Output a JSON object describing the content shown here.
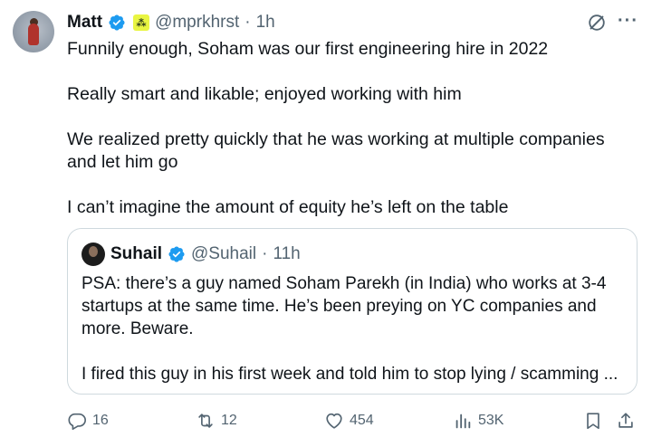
{
  "tweet": {
    "author": {
      "name": "Matt",
      "handle": "@mprkhrst",
      "separator": "·",
      "time": "1h",
      "verified_color": "#1d9bf0"
    },
    "paragraphs": [
      "Funnily enough, Soham was our first engineering hire in 2022",
      "Really smart and likable; enjoyed working with him",
      "We realized pretty quickly that he was working at multiple companies and let him go",
      "I can’t imagine the amount of equity he’s left on the table"
    ],
    "quote": {
      "author": {
        "name": "Suhail",
        "handle": "@Suhail",
        "separator": "·",
        "time": "11h"
      },
      "paragraphs": [
        "PSA: there’s a guy named Soham Parekh (in India) who works at 3-4 startups at the same time. He’s been preying on YC companies and more. Beware.",
        "I fired this guy in his first week and told him to stop lying / scamming ..."
      ]
    },
    "metrics": {
      "replies": "16",
      "reposts": "12",
      "likes": "454",
      "views": "53K"
    },
    "icons": {
      "grok": "grok-icon",
      "more": "more-icon",
      "reply": "reply-icon",
      "repost": "repost-icon",
      "like": "heart-icon",
      "views": "views-icon",
      "bookmark": "bookmark-icon",
      "share": "share-icon"
    },
    "colors": {
      "text": "#0f1419",
      "secondary": "#536471",
      "border": "#cfd9de",
      "verified": "#1d9bf0"
    }
  }
}
